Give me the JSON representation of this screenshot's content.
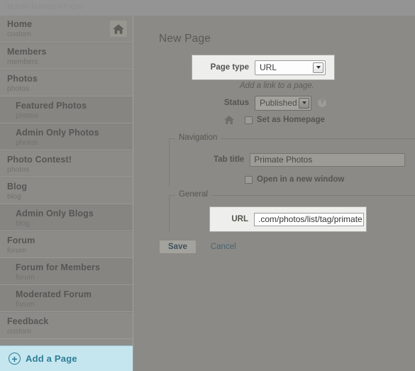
{
  "sidebar": {
    "heading": "MAIN NAVIGATION",
    "items": [
      {
        "label": "Home",
        "sub": "custom",
        "child": false,
        "home_icon": "home-icon"
      },
      {
        "label": "Members",
        "sub": "members",
        "child": false
      },
      {
        "label": "Photos",
        "sub": "photos",
        "child": false
      },
      {
        "label": "Featured Photos",
        "sub": "photos",
        "child": true
      },
      {
        "label": "Admin Only Photos",
        "sub": "photos",
        "child": true
      },
      {
        "label": "Photo Contest!",
        "sub": "photos",
        "child": false
      },
      {
        "label": "Blog",
        "sub": "blog",
        "child": false
      },
      {
        "label": "Admin Only Blogs",
        "sub": "blog",
        "child": true
      },
      {
        "label": "Forum",
        "sub": "forum",
        "child": false
      },
      {
        "label": "Forum for Members",
        "sub": "forum",
        "child": true
      },
      {
        "label": "Moderated Forum",
        "sub": "forum",
        "child": true
      },
      {
        "label": "Feedback",
        "sub": "custom",
        "child": false
      }
    ],
    "add_page_label": "Add a Page",
    "add_page_icon": "plus-circle-icon"
  },
  "main": {
    "title": "New Page",
    "page_type": {
      "label": "Page type",
      "value": "URL",
      "hint": "Add a link to a page."
    },
    "status": {
      "label": "Status",
      "value": "Published",
      "help_icon": "question-mark-icon"
    },
    "homepage": {
      "icon": "home-icon",
      "label": "Set as Homepage",
      "checked": false
    },
    "navigation_fieldset": {
      "legend": "Navigation",
      "tab_title": {
        "label": "Tab title",
        "value": "Primate Photos",
        "placeholder": ""
      },
      "new_window": {
        "label": "Open in a new window",
        "checked": false
      }
    },
    "general_fieldset": {
      "legend": "General",
      "url": {
        "label": "URL",
        "value": ".com/photos/list/tag/primate",
        "placeholder": ""
      }
    },
    "actions": {
      "save_label": "Save",
      "cancel_label": "Cancel"
    }
  },
  "colors": {
    "accent": "#2f7e96",
    "add_page_bg": "#c5e6ef",
    "spotlight": "#eeeeec",
    "dim_overlay": "#8b8a86"
  }
}
